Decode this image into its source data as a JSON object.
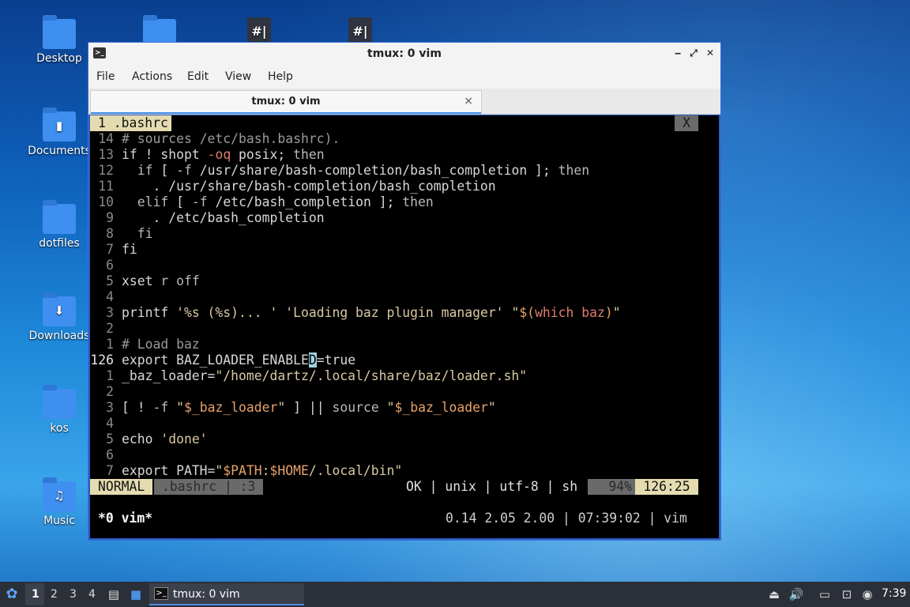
{
  "desktop": {
    "icons": [
      {
        "label": "Desktop",
        "icon": "folder-icon"
      },
      {
        "label": "Documents",
        "icon": "folder-documents-icon"
      },
      {
        "label": "dotfiles",
        "icon": "folder-icon"
      },
      {
        "label": "Downloads",
        "icon": "folder-downloads-icon"
      },
      {
        "label": "kos",
        "icon": "folder-icon"
      },
      {
        "label": "Music",
        "icon": "folder-music-icon"
      }
    ]
  },
  "window": {
    "title": "tmux: 0 vim",
    "menu": [
      "File",
      "Actions",
      "Edit",
      "View",
      "Help"
    ],
    "tab_title": "tmux: 0 vim",
    "tab_close": "×",
    "controls": {
      "minimize": "‒",
      "maximize": "⤢",
      "close": "✕"
    }
  },
  "vim": {
    "buffer_tab": "1 .bashrc",
    "buffer_close": "X",
    "lines": [
      {
        "n": "14",
        "text": "# sources /etc/bash.bashrc)."
      },
      {
        "n": "13",
        "text": "if ! shopt -oq posix; then"
      },
      {
        "n": "12",
        "text": "  if [ -f /usr/share/bash-completion/bash_completion ]; then"
      },
      {
        "n": "11",
        "text": "    . /usr/share/bash-completion/bash_completion"
      },
      {
        "n": "10",
        "text": "  elif [ -f /etc/bash_completion ]; then"
      },
      {
        "n": "9",
        "text": "    . /etc/bash_completion"
      },
      {
        "n": "8",
        "text": "  fi"
      },
      {
        "n": "7",
        "text": "fi"
      },
      {
        "n": "6",
        "text": ""
      },
      {
        "n": "5",
        "text": "xset r off"
      },
      {
        "n": "4",
        "text": ""
      },
      {
        "n": "3",
        "text": "printf '%s (%s)... ' 'Loading baz plugin manager' \"$(which baz)\""
      },
      {
        "n": "2",
        "text": ""
      },
      {
        "n": "1",
        "text": "# Load baz"
      },
      {
        "n": "126",
        "text": "export BAZ_LOADER_ENABLED=true"
      },
      {
        "n": "1",
        "text": "_baz_loader=\"/home/dartz/.local/share/baz/loader.sh\""
      },
      {
        "n": "2",
        "text": ""
      },
      {
        "n": "3",
        "text": "[ ! -f \"$_baz_loader\" ] || source \"$_baz_loader\""
      },
      {
        "n": "4",
        "text": ""
      },
      {
        "n": "5",
        "text": "echo 'done'"
      },
      {
        "n": "6",
        "text": ""
      },
      {
        "n": "7",
        "text": "export PATH=\"$PATH:$HOME/.local/bin\""
      }
    ],
    "status": {
      "mode": "NORMAL",
      "file": ".bashrc | :3",
      "info": "OK | unix | utf-8 | sh",
      "percent": "94%",
      "position": "126:25"
    }
  },
  "tmux": {
    "window_list": "*0 vim*",
    "right": "0.14 2.05 2.00 | 07:39:02 | vim"
  },
  "taskbar": {
    "workspaces": [
      "1",
      "2",
      "3",
      "4"
    ],
    "active_workspace": "1",
    "task_label": "tmux: 0 vim",
    "clock": "7:39"
  }
}
